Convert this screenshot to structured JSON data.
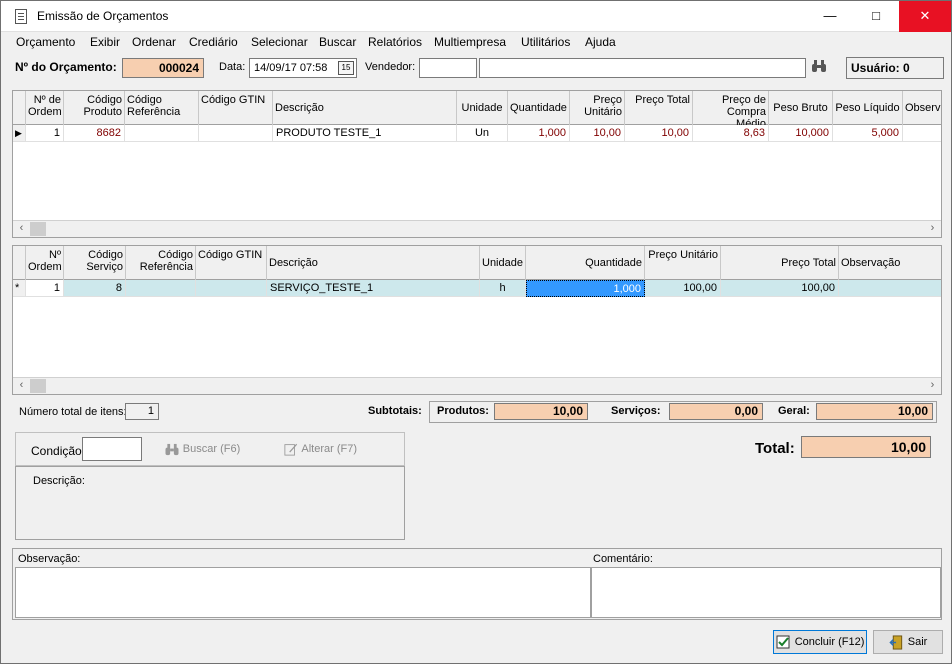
{
  "window": {
    "title": "Emissão de Orçamentos",
    "minimize": "—",
    "maximize": "□",
    "close": "✕"
  },
  "menu": [
    "Orçamento",
    "Exibir",
    "Ordenar",
    "Crediário",
    "Selecionar",
    "Buscar",
    "Relatórios",
    "Multiempresa",
    "Utilitários",
    "Ajuda"
  ],
  "toolbar": {
    "order_label": "Nº do Orçamento:",
    "order_number": "000024",
    "date_label": "Data:",
    "date_value": "14/09/17 07:58",
    "calendar_glyph": "15",
    "seller_label": "Vendedor:",
    "seller_code": "",
    "seller_name": "",
    "user_label": "Usuário: 0"
  },
  "products": {
    "headers": [
      "Nº de Ordem",
      "Código Produto",
      "Código Referência",
      "Código GTIN",
      "Descrição",
      "Unidade",
      "Quantidade",
      "Preço Unitário",
      "Preço Total",
      "Preço de Compra Médio",
      "Peso Bruto",
      "Peso Líquido",
      "Observa"
    ],
    "rows": [
      {
        "order": "1",
        "code": "8682",
        "ref": "",
        "gtin": "",
        "desc": "PRODUTO TESTE_1",
        "unit": "Un",
        "qty": "1,000",
        "unit_price": "10,00",
        "total": "10,00",
        "avg_cost": "8,63",
        "gross": "10,000",
        "net": "5,000",
        "obs": ""
      }
    ]
  },
  "services": {
    "headers": [
      "Nº Ordem",
      "Código Serviço",
      "Código Referência",
      "Código GTIN",
      "Descrição",
      "Unidade",
      "Quantidade",
      "Preço Unitário",
      "Preço Total",
      "Observação"
    ],
    "rows": [
      {
        "marker": "*",
        "order": "1",
        "code": "8",
        "ref": "",
        "gtin": "",
        "desc": "SERVIÇO_TESTE_1",
        "unit": "h",
        "qty": "1,000",
        "unit_price": "100,00",
        "total": "100,00",
        "obs": ""
      }
    ]
  },
  "totals": {
    "items_label": "Número total de itens:",
    "items_count": "1",
    "subtotals_label": "Subtotais:",
    "products_label": "Produtos:",
    "products_value": "10,00",
    "services_label": "Serviços:",
    "services_value": "0,00",
    "general_label": "Geral:",
    "general_value": "10,00",
    "total_label": "Total:",
    "total_value": "10,00"
  },
  "condition": {
    "label": "Condição:",
    "value": "",
    "search_button": "Buscar (F6)",
    "alter_button": "Alterar (F7)",
    "description_label": "Descrição:"
  },
  "notes": {
    "observation_label": "Observação:",
    "comment_label": "Comentário:"
  },
  "footer": {
    "conclude_button": "Concluir (F12)",
    "exit_button": "Sair"
  }
}
